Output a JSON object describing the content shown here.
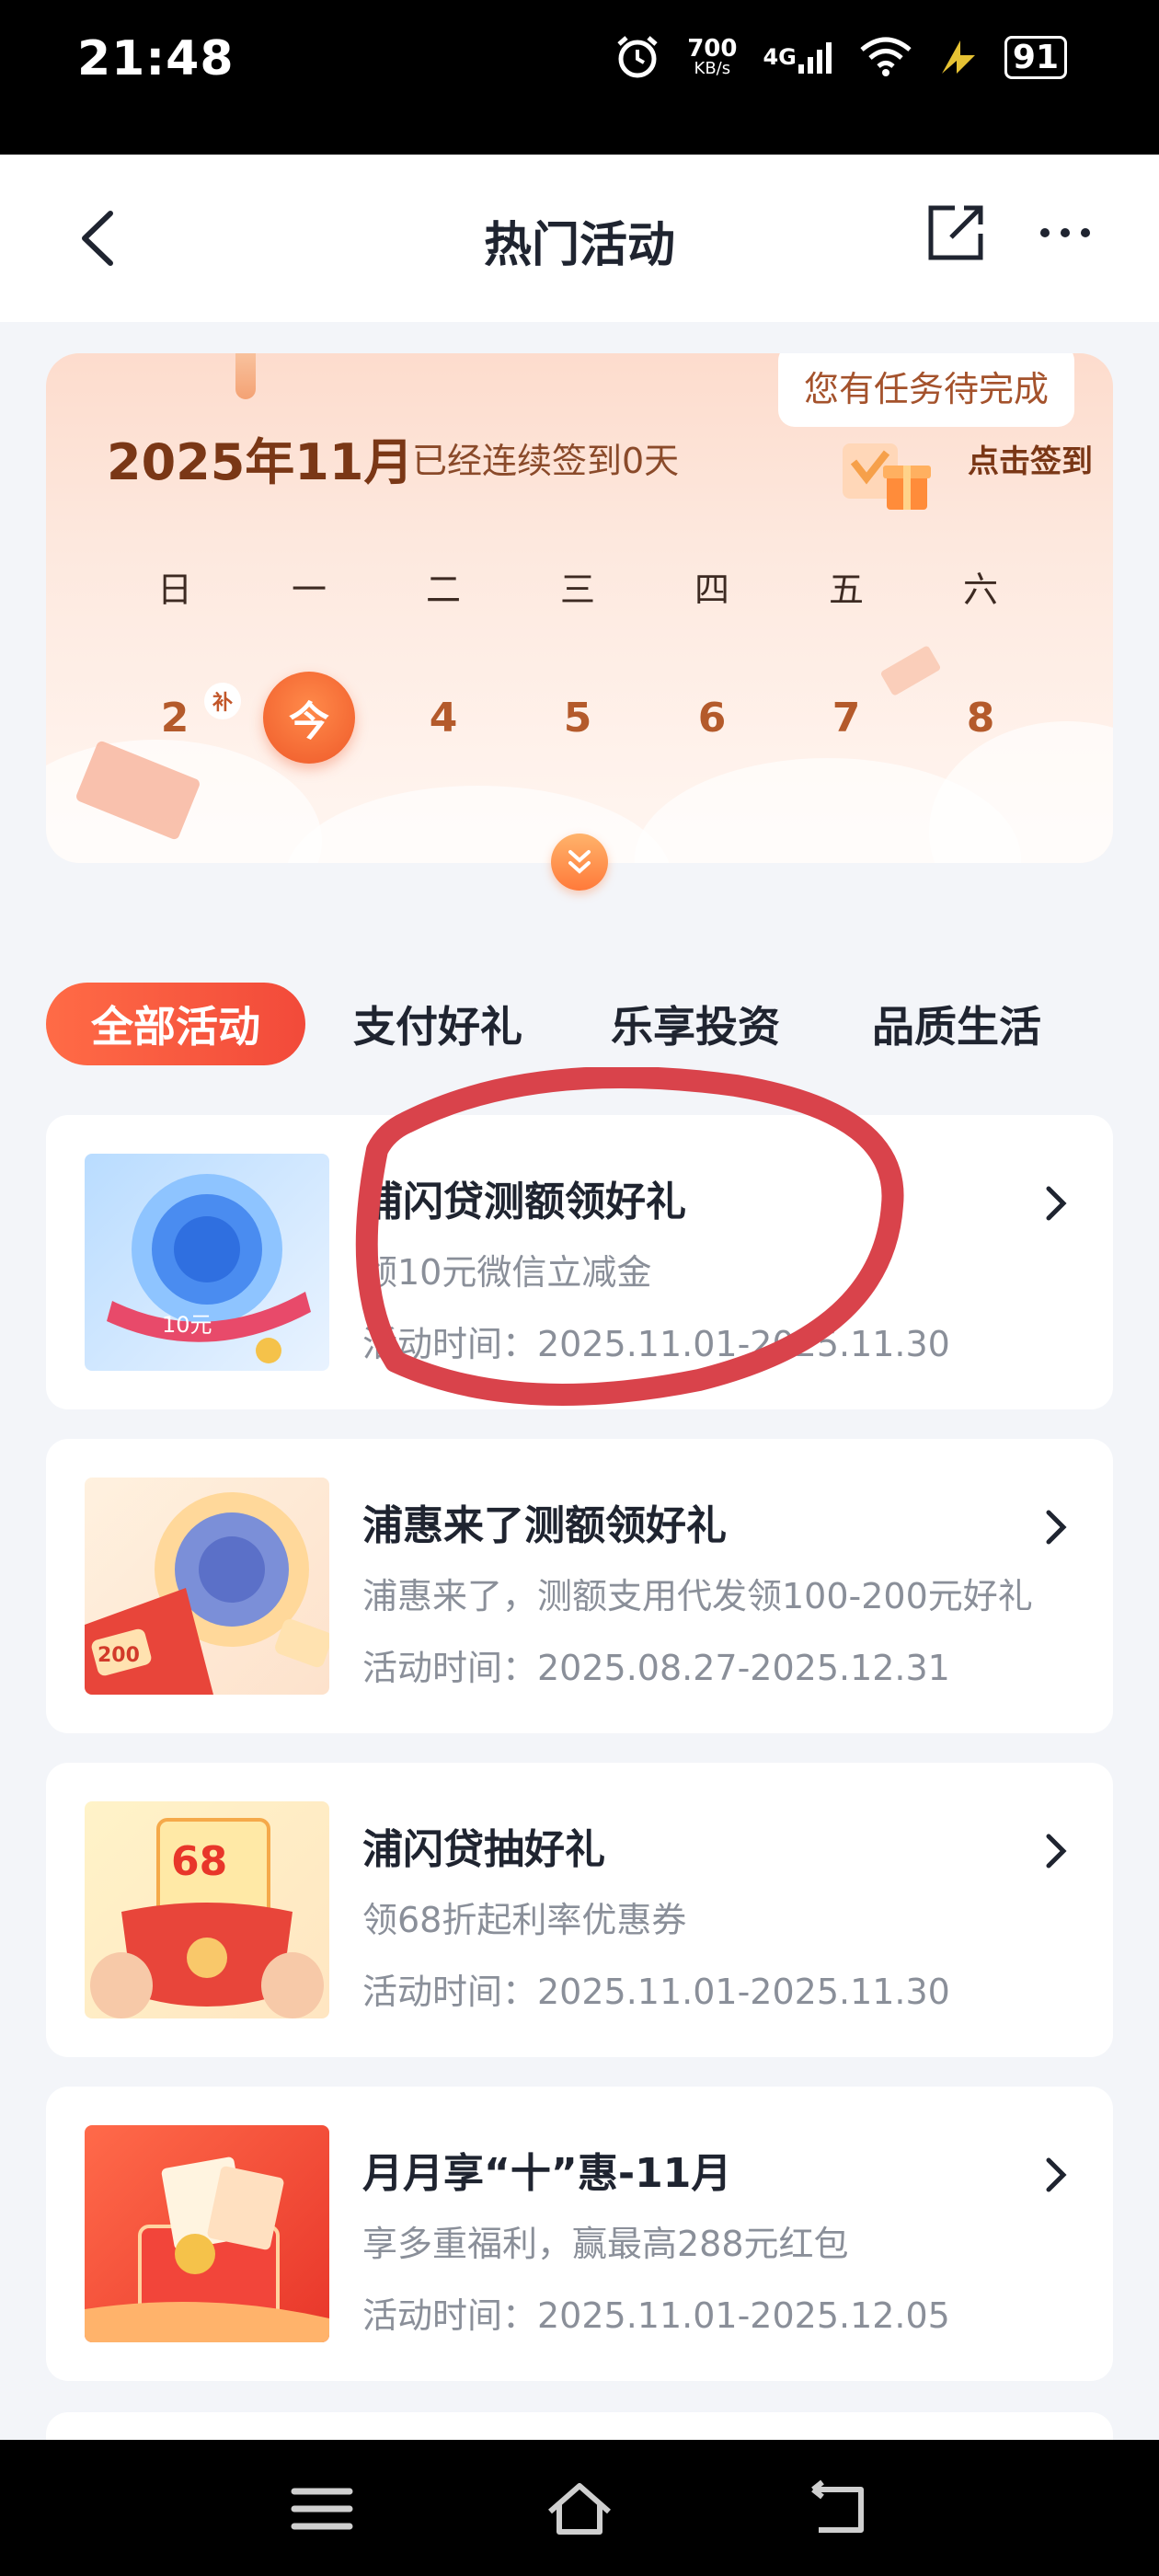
{
  "status_bar": {
    "time": "21:48",
    "speed_value": "700",
    "speed_unit": "KB/s",
    "network": "4G",
    "battery": "91"
  },
  "nav": {
    "title": "热门活动",
    "icons": [
      "back-icon",
      "share-icon",
      "more-icon"
    ]
  },
  "signin": {
    "month": "2025年11月",
    "streak": "已经连续签到0天",
    "task_bubble": "您有任务待完成",
    "signin_button": "点击签到",
    "weekdays": [
      "日",
      "一",
      "二",
      "三",
      "四",
      "五",
      "六"
    ],
    "days": [
      "2",
      "今",
      "4",
      "5",
      "6",
      "7",
      "8"
    ],
    "makeup_tag": "补"
  },
  "tabs": [
    {
      "label": "全部活动",
      "active": true
    },
    {
      "label": "支付好礼",
      "active": false
    },
    {
      "label": "乐享投资",
      "active": false
    },
    {
      "label": "品质生活",
      "active": false
    }
  ],
  "activities": [
    {
      "title": "浦闪贷测额领好礼",
      "desc": "领10元微信立减金",
      "time": "活动时间：2025.11.01-2025.11.30",
      "thumb_text": "10元"
    },
    {
      "title": "浦惠来了测额领好礼",
      "desc": "浦惠来了，测额支用代发领100-200元好礼",
      "time": "活动时间：2025.08.27-2025.12.31",
      "thumb_text": "200"
    },
    {
      "title": "浦闪贷抽好礼",
      "desc": "领68折起利率优惠券",
      "time": "活动时间：2025.11.01-2025.11.30",
      "thumb_text": "68"
    },
    {
      "title": "月月享“十”惠-11月",
      "desc": "享多重福利，赢最高288元红包",
      "time": "活动时间：2025.11.01-2025.12.05",
      "thumb_text": ""
    }
  ],
  "colors": {
    "accent": "#f24a3a",
    "accent_light": "#ff6b46",
    "annotation": "#d9434b"
  }
}
